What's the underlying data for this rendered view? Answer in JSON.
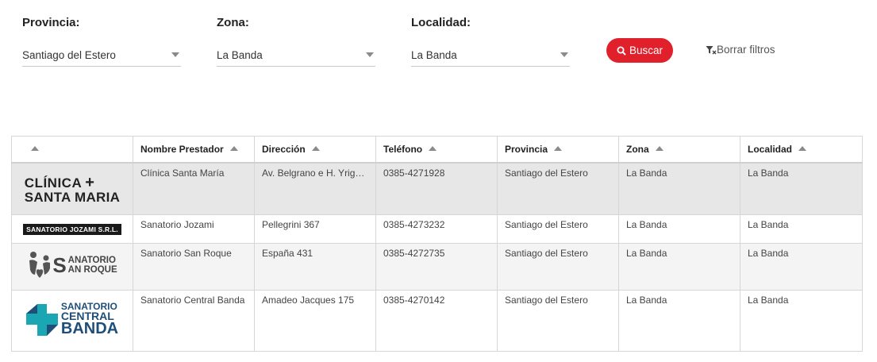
{
  "filters": {
    "provincia": {
      "label": "Provincia:",
      "value": "Santiago del Estero"
    },
    "zona": {
      "label": "Zona:",
      "value": "La Banda"
    },
    "localidad": {
      "label": "Localidad:",
      "value": "La Banda"
    },
    "buscar_label": "Buscar",
    "borrar_label": "Borrar filtros"
  },
  "table": {
    "headers": [
      "Nombre Prestador",
      "Dirección",
      "Teléfono",
      "Provincia",
      "Zona",
      "Localidad"
    ],
    "rows": [
      {
        "logo": {
          "line1": "CLÍNICA",
          "line2": "SANTA MARIA",
          "plus": "+"
        },
        "nombre": "Clínica Santa María",
        "direccion": "Av. Belgrano e H. Yrigoyen",
        "telefono": "0385-4271928",
        "provincia": "Santiago del Estero",
        "zona": "La Banda",
        "localidad": "La Banda"
      },
      {
        "logo": {
          "text": "SANATORIO JOZAMI S.R.L."
        },
        "nombre": "Sanatorio Jozami",
        "direccion": "Pellegrini 367",
        "telefono": "0385-4273232",
        "provincia": "Santiago del Estero",
        "zona": "La Banda",
        "localidad": "La Banda"
      },
      {
        "logo": {
          "big": "S",
          "line1": "ANATORIO",
          "line2": "AN ROQUE"
        },
        "nombre": "Sanatorio San Roque",
        "direccion": "España 431",
        "telefono": "0385-4272735",
        "provincia": "Santiago del Estero",
        "zona": "La Banda",
        "localidad": "La Banda"
      },
      {
        "logo": {
          "line1": "SANATORIO",
          "line2": "CENTRAL",
          "line3": "BANDA"
        },
        "nombre": "Sanatorio Central Banda",
        "direccion": "Amadeo Jacques 175",
        "telefono": "0385-4270142",
        "provincia": "Santiago del Estero",
        "zona": "La Banda",
        "localidad": "La Banda"
      }
    ]
  },
  "colors": {
    "accent": "#e0202a",
    "logo_blue": "#1f4e79",
    "logo_teal": "#1aa7b3"
  }
}
